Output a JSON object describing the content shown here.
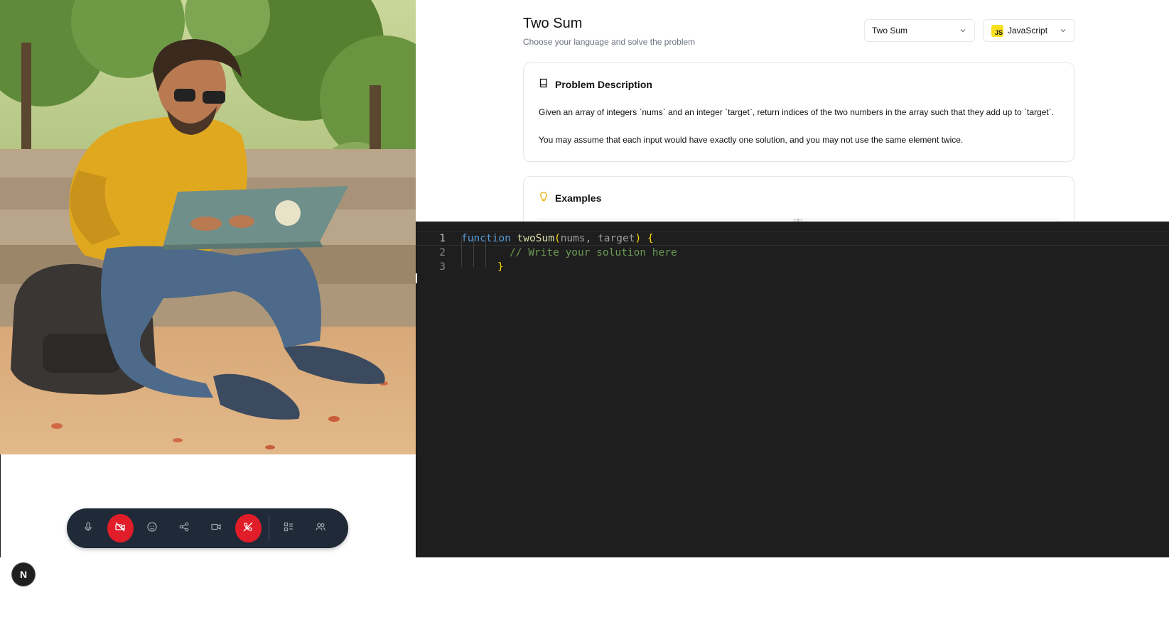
{
  "problem": {
    "title": "Two Sum",
    "subtitle": "Choose your language and solve the problem",
    "problem_select": "Two Sum",
    "language_select": "JavaScript",
    "language_badge": "JS"
  },
  "description": {
    "heading": "Problem Description",
    "p1": "Given an array of integers `nums` and an integer `target`, return indices of the two numbers in the array such that they add up to `target`.",
    "p2": "You may assume that each input would have exactly one solution, and you may not use the same element twice."
  },
  "examples": {
    "heading": "Examples"
  },
  "editor": {
    "line_numbers": [
      "1",
      "2",
      "3"
    ],
    "line1": {
      "keyword": "function",
      "name": "twoSum",
      "open": "(",
      "params": "nums, target",
      "close": ")",
      "brace": "{"
    },
    "line2": {
      "comment": "// Write your solution here"
    },
    "line3": {
      "brace": "}"
    }
  },
  "controls": [
    {
      "name": "microphone-icon"
    },
    {
      "name": "camera-off-icon",
      "state": "active-red"
    },
    {
      "name": "emoji-icon"
    },
    {
      "name": "share-icon"
    },
    {
      "name": "video-icon"
    },
    {
      "name": "end-call-icon",
      "state": "active-red"
    },
    {
      "name": "layout-icon"
    },
    {
      "name": "participants-icon"
    }
  ],
  "badge": {
    "letter": "N"
  },
  "colors": {
    "control_bar": "#1f2937",
    "danger": "#e11d2a",
    "editor_bg": "#1e1e1e",
    "js_yellow": "#f7df1e"
  }
}
